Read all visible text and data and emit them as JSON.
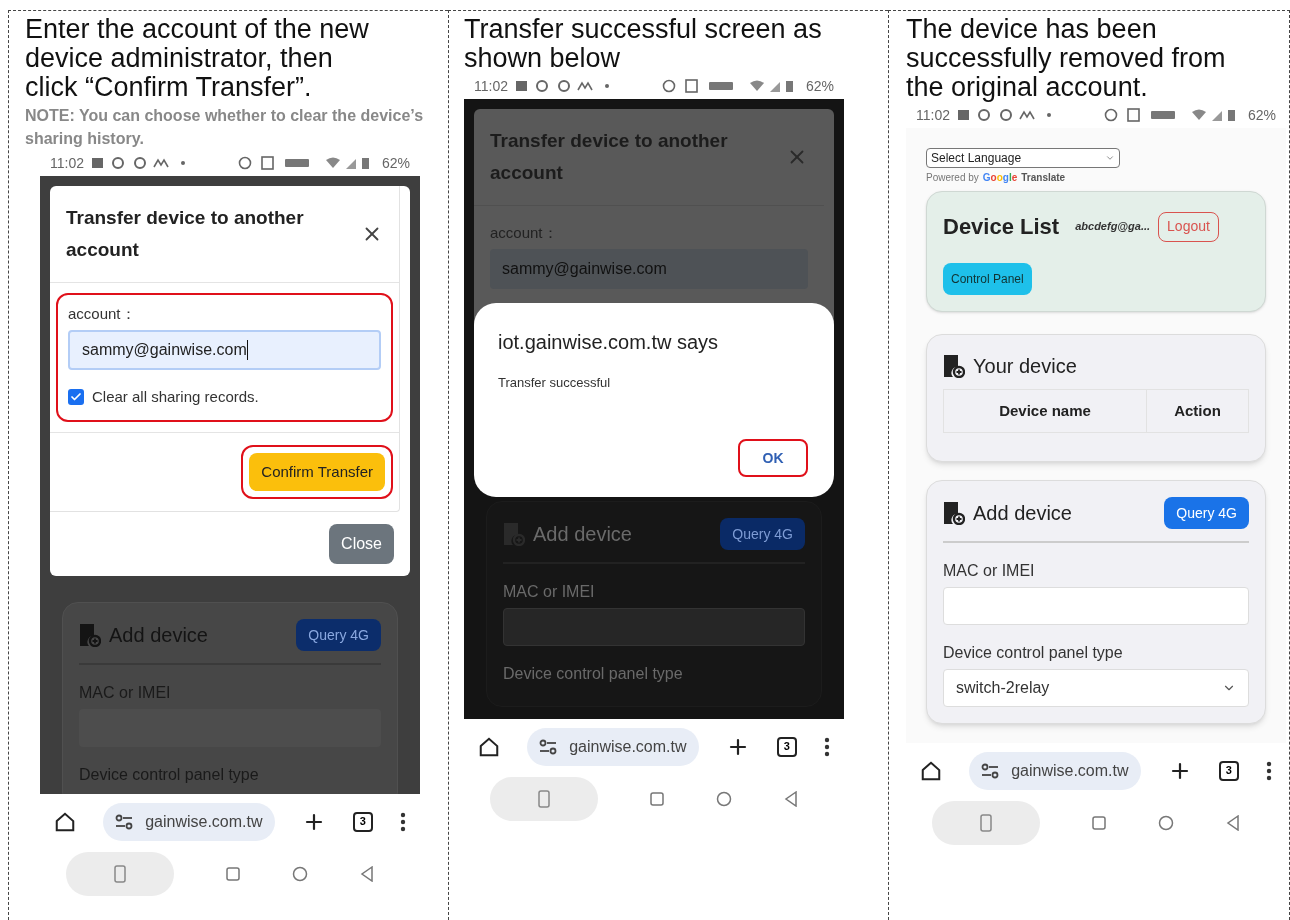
{
  "panels": [
    {
      "kind": "transfer_form",
      "caption": "Enter the account of the new device administrator, then click “Confirm Transfer”.",
      "note": "NOTE: You can choose whether to clear the device’s sharing history.",
      "status": {
        "time": "11:02",
        "battery": "62%"
      },
      "dialog": {
        "title": "Transfer device to another account",
        "field_label": "account：",
        "field_value": "sammy@gainwise.com",
        "field_highlighted": true,
        "checkbox": {
          "label": "Clear all sharing records.",
          "checked": true
        },
        "primary_button": "Confirm Transfer",
        "primary_highlighted": true,
        "close_button": "Close"
      },
      "add_device": {
        "title": "Add device",
        "query_button": "Query 4G",
        "field_label": "MAC or IMEI",
        "select_label": "Device control panel type"
      },
      "browser": {
        "url": "gainwise.com.tw",
        "tab_count": "3"
      }
    },
    {
      "kind": "alert",
      "caption": "Transfer successful screen as shown below",
      "status": {
        "time": "11:02",
        "battery": "62%"
      },
      "dialog": {
        "title": "Transfer device to another account",
        "field_label": "account：",
        "field_value": "sammy@gainwise.com"
      },
      "alert": {
        "title": "iot.gainwise.com.tw says",
        "message": "Transfer successful",
        "button": "OK",
        "button_highlighted": true
      },
      "add_device": {
        "title": "Add device",
        "query_button": "Query 4G",
        "field_label": "MAC or IMEI",
        "select_label": "Device control panel type"
      },
      "browser": {
        "url": "gainwise.com.tw",
        "tab_count": "3"
      }
    },
    {
      "kind": "device_list",
      "caption": "The device has been successfully removed from the original account.",
      "status": {
        "time": "11:02",
        "battery": "62%"
      },
      "language": {
        "select": "Select Language",
        "powered_by": "Powered by",
        "google": "Google",
        "translate": "Translate"
      },
      "header": {
        "title": "Device List",
        "user": "abcdefg@ga...",
        "logout": "Logout",
        "control_panel": "Control Panel"
      },
      "your_device": {
        "title": "Your device",
        "columns": [
          "Device name",
          "Action"
        ]
      },
      "add_device": {
        "title": "Add device",
        "query_button": "Query 4G",
        "field_label": "MAC or IMEI",
        "select_label": "Device control panel type",
        "select_value": "switch-2relay"
      },
      "browser": {
        "url": "gainwise.com.tw",
        "tab_count": "3"
      }
    }
  ]
}
